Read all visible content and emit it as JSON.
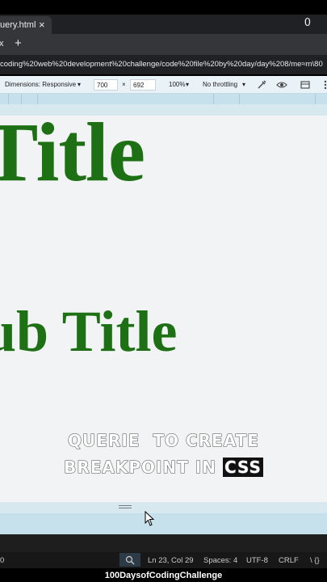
{
  "browser": {
    "tab_title": "uery.html",
    "tab_close": "×",
    "window_control": "0",
    "nav_close": "x",
    "new_tab": "+",
    "url": "coding%20web%20development%20challenge/code%20file%20by%20day/day%208/me≈m\\80"
  },
  "device_toolbar": {
    "dimensions_label": "Dimensions: Responsive",
    "width": "700",
    "times": "×",
    "height": "692",
    "zoom": "100%",
    "throttling": "No throttling",
    "icons": [
      "eyedropper-icon",
      "eye-icon",
      "device-layout-icon",
      "more-icon"
    ]
  },
  "page": {
    "title": "Title",
    "subtitle": "ub Title"
  },
  "overlay": {
    "line1": "QUERIE  TO CREATE",
    "line2_prefix": "BREAKPOINT IN ",
    "line2_highlight": "CSS"
  },
  "status_bar": {
    "left": "0",
    "position": "Ln 23, Col 29",
    "spaces": "Spaces: 4",
    "encoding": "UTF-8",
    "eol": "CRLF",
    "right": "\\ {}"
  },
  "caption": "100DaysofCodingChallenge",
  "colors": {
    "heading_green": "#1d7014",
    "viewport_bg": "#f1f3f4",
    "toolbar_bg": "#e9f2f6",
    "ruler_bg": "#c6e1eb"
  }
}
